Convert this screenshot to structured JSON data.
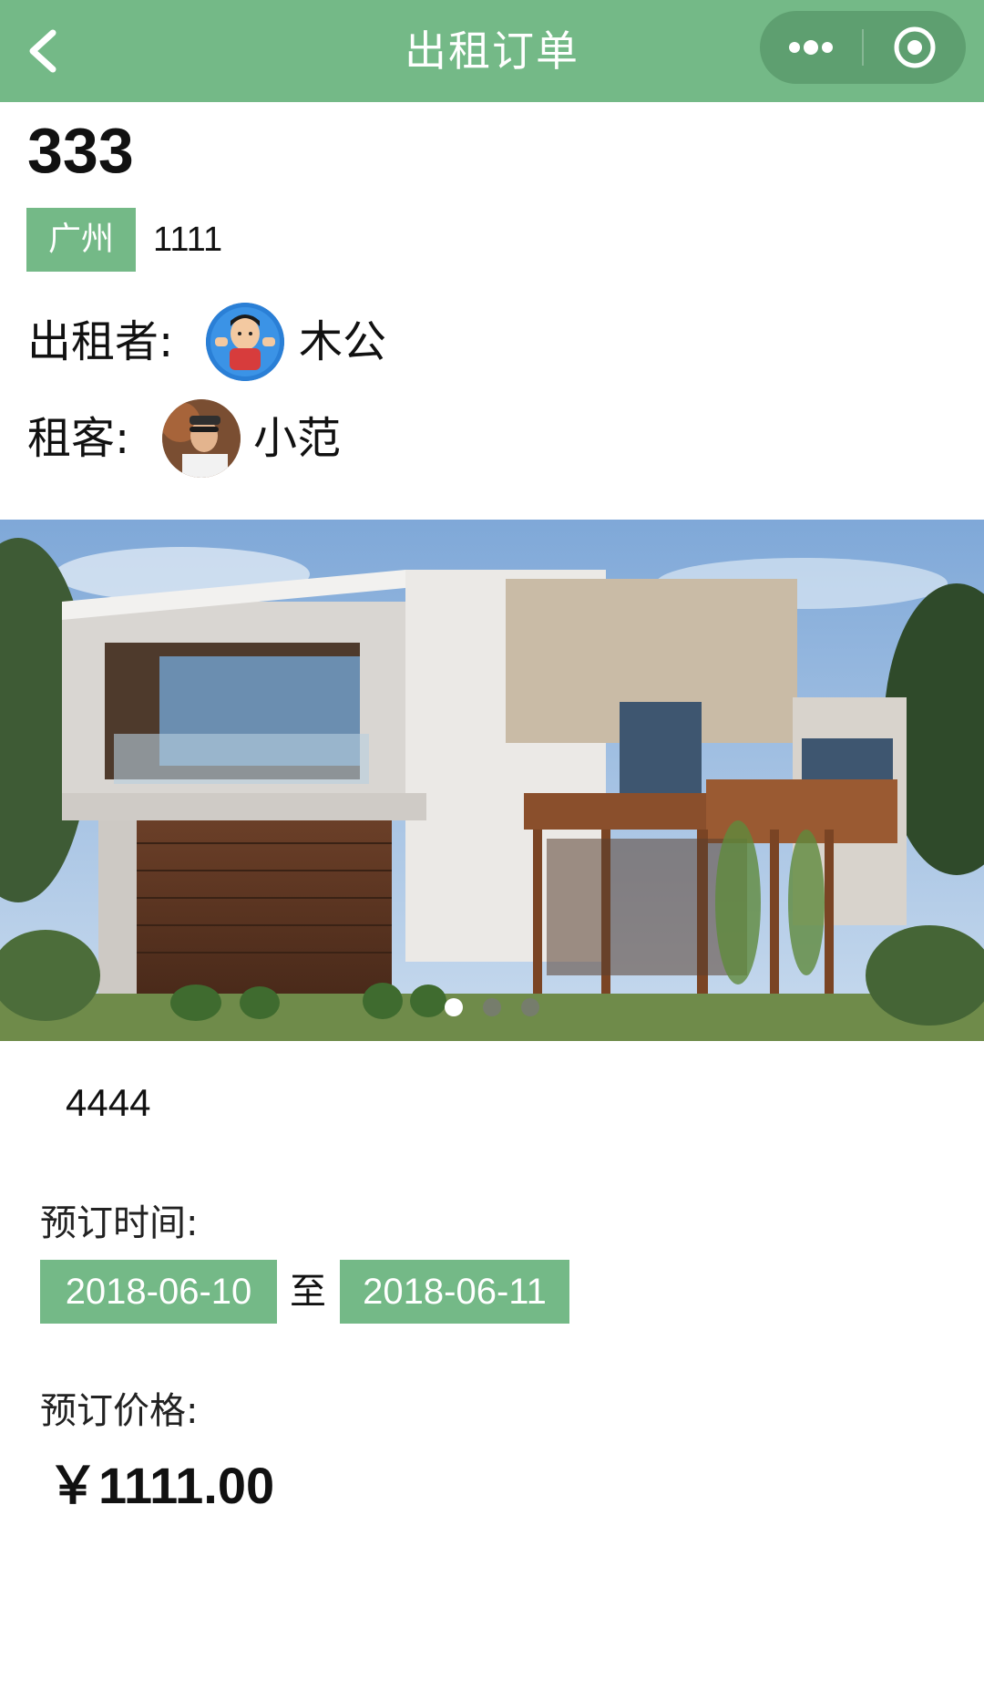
{
  "navbar": {
    "title": "出租订单",
    "back_icon": "chevron-left-icon",
    "more_icon": "more-dots-icon",
    "close_icon": "target-icon",
    "background": "#74b987"
  },
  "listing": {
    "title": "333",
    "city": "广州",
    "city_detail": "1111",
    "landlord_label": "出租者:",
    "landlord_name": "木公",
    "tenant_label": "租客:",
    "tenant_name": "小范",
    "description": "4444"
  },
  "carousel": {
    "image": "modern-two-story-house-photo",
    "slide_count": 3,
    "active_index": 0
  },
  "booking": {
    "time_label": "预订时间:",
    "start_date": "2018-06-10",
    "separator": "至",
    "end_date": "2018-06-11",
    "price_label": "预订价格:",
    "price": "￥1111.00"
  },
  "colors": {
    "accent": "#74b987"
  }
}
